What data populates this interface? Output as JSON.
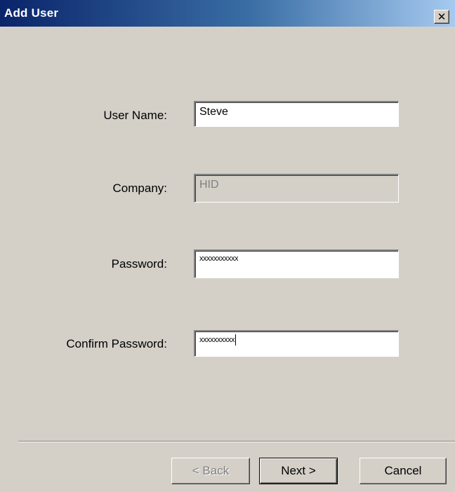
{
  "window": {
    "title": "Add User",
    "close_icon": "✕"
  },
  "form": {
    "user_name": {
      "label": "User Name:",
      "value": "Steve"
    },
    "company": {
      "label": "Company:",
      "value": "HID"
    },
    "password": {
      "label": "Password:",
      "value": "xxxxxxxxxxx"
    },
    "confirm_password": {
      "label": "Confirm Password:",
      "value": "xxxxxxxxxx"
    }
  },
  "buttons": {
    "back": "< Back",
    "next": "Next >",
    "cancel": "Cancel"
  }
}
